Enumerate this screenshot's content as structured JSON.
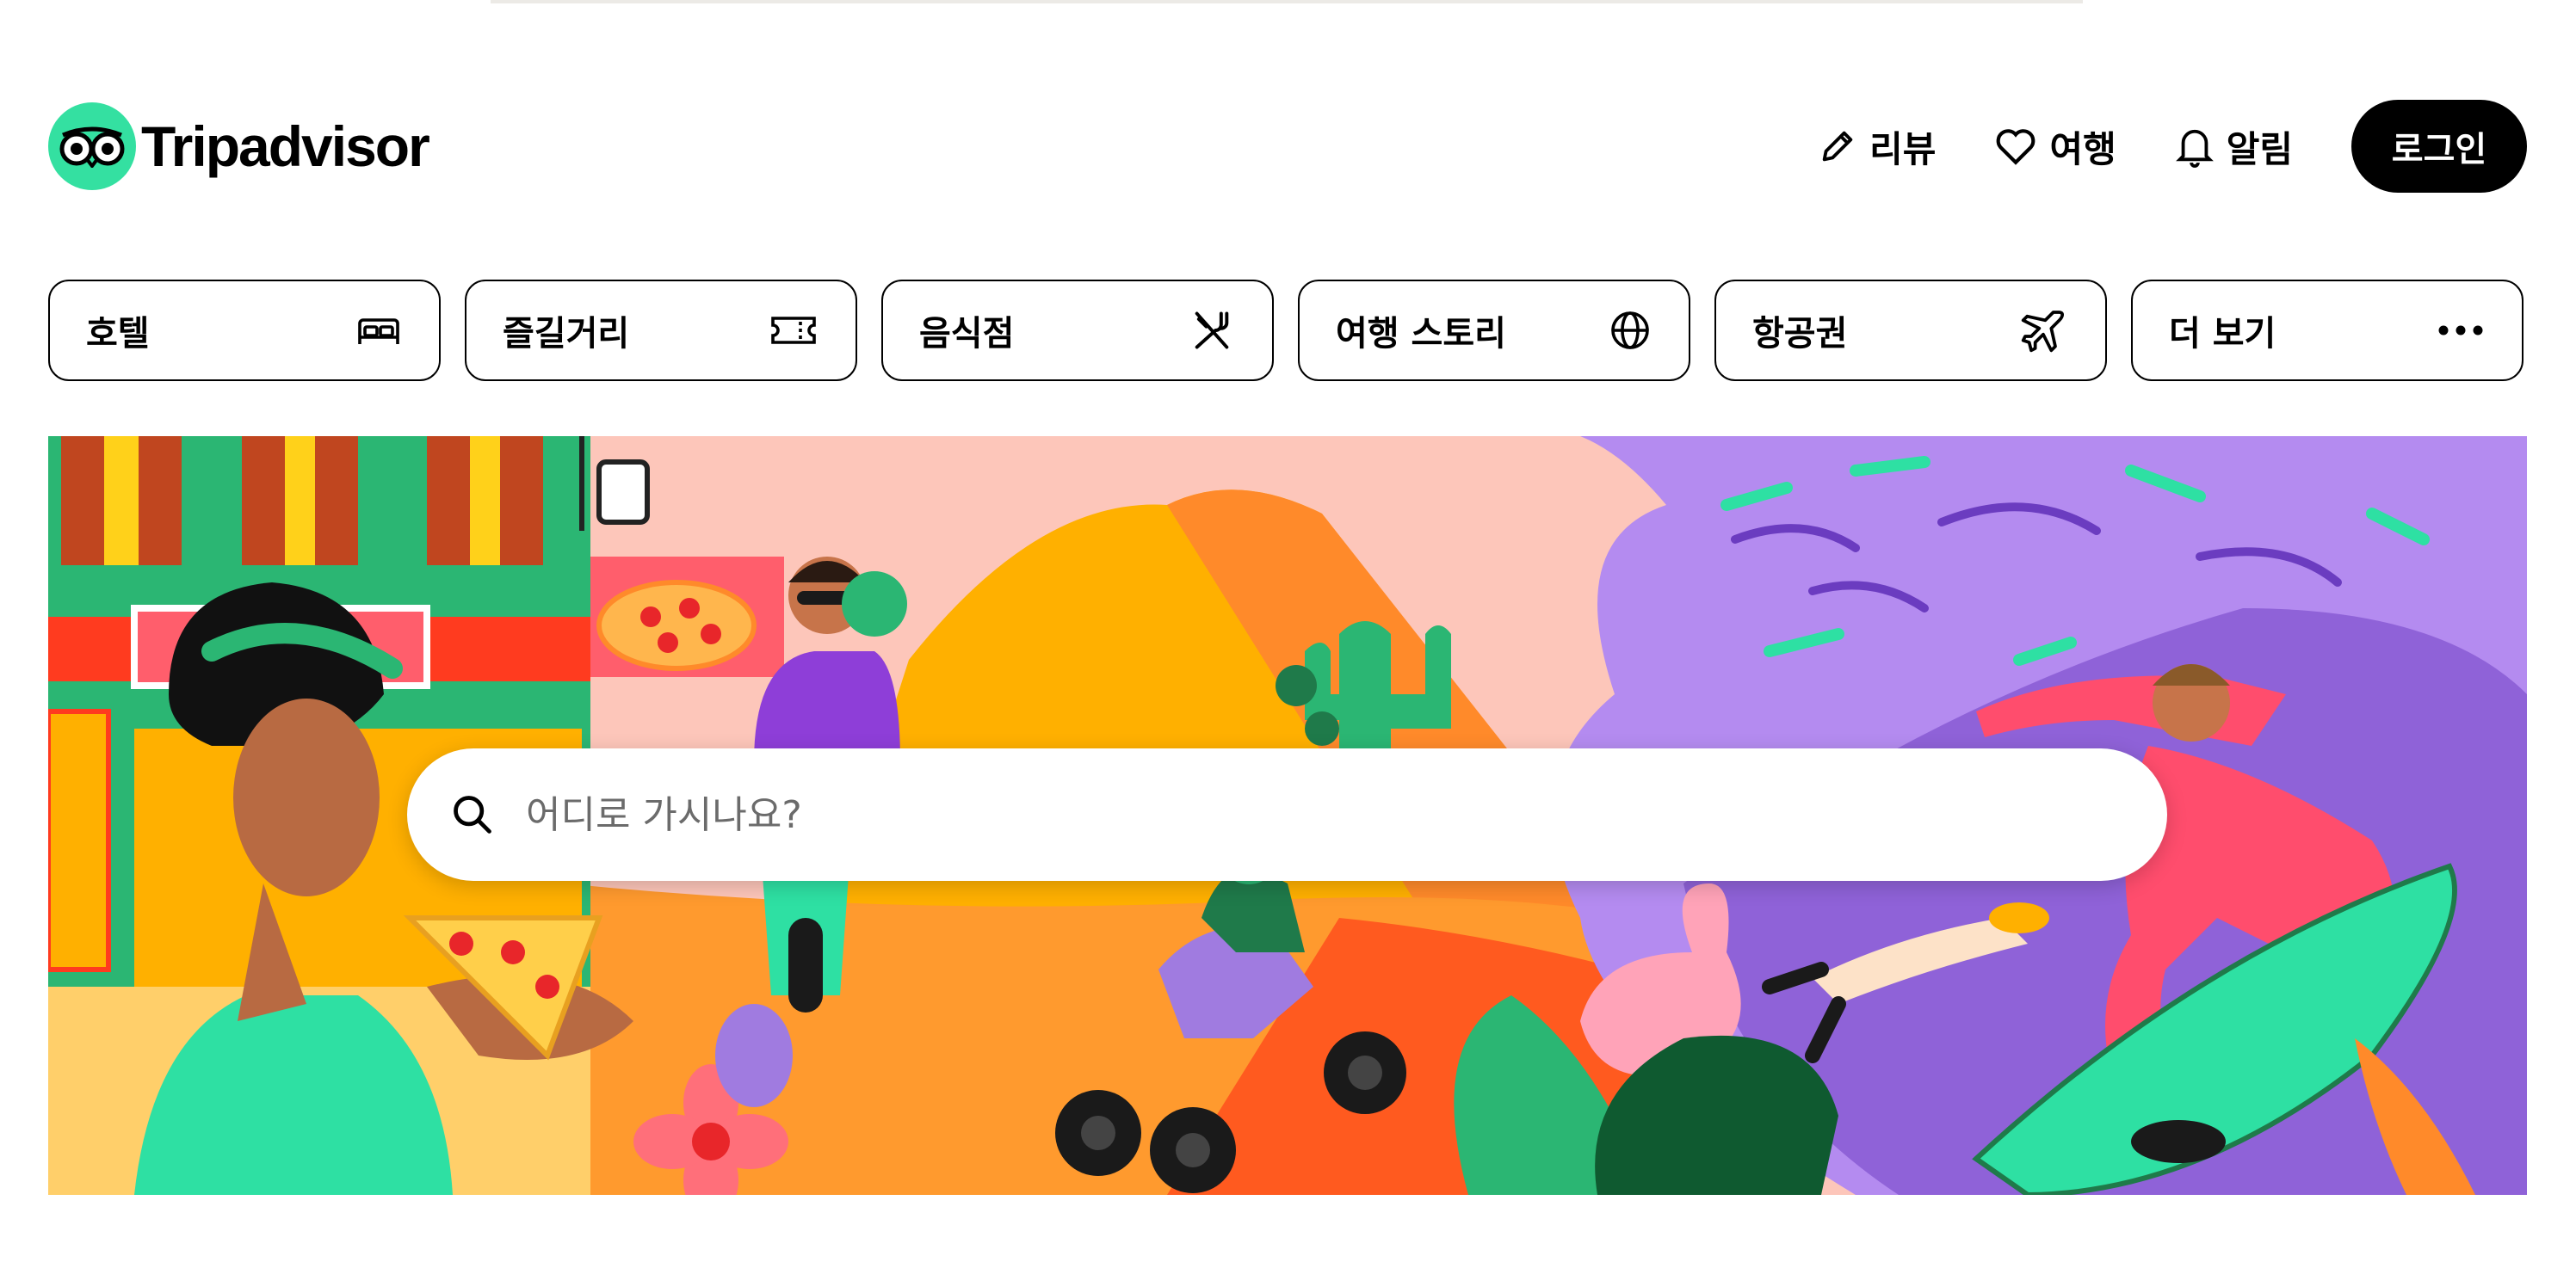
{
  "brand": {
    "name": "Tripadvisor",
    "accent": "#34e0a1"
  },
  "nav": [
    {
      "icon": "pencil-icon",
      "label": "리뷰"
    },
    {
      "icon": "heart-icon",
      "label": "여행"
    },
    {
      "icon": "bell-icon",
      "label": "알림"
    }
  ],
  "login_label": "로그인",
  "categories": [
    {
      "label": "호텔",
      "icon": "bed-icon"
    },
    {
      "label": "즐길거리",
      "icon": "ticket-icon"
    },
    {
      "label": "음식점",
      "icon": "utensils-icon"
    },
    {
      "label": "여행 스토리",
      "icon": "globe-icon"
    },
    {
      "label": "항공권",
      "icon": "plane-icon"
    },
    {
      "label": "더 보기",
      "icon": "more-dots-icon"
    }
  ],
  "search": {
    "placeholder": "어디로 가시나요?",
    "icon": "search-icon"
  },
  "hero": {
    "description_icon": "travel-illustration"
  }
}
